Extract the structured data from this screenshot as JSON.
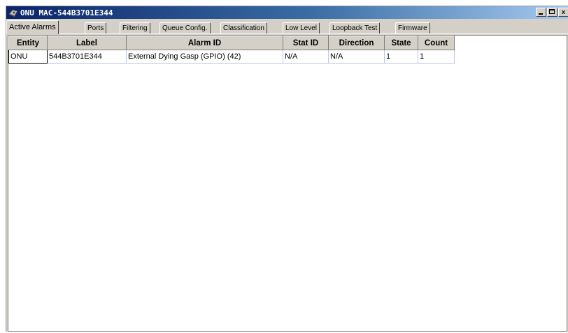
{
  "window": {
    "title": "ONU MAC-544B3701E344",
    "controls": {
      "minimize": "minimize",
      "maximize": "maximize",
      "close": "x"
    }
  },
  "tabs": [
    {
      "label": "Active Alarms",
      "active": true
    },
    {
      "label": "Ports"
    },
    {
      "label": "Filtering"
    },
    {
      "label": "Queue Config."
    },
    {
      "label": "Classification"
    },
    {
      "label": "Low Level"
    },
    {
      "label": "Loopback Test"
    },
    {
      "label": "Firmware"
    }
  ],
  "table": {
    "columns": [
      "Entity",
      "Label",
      "Alarm ID",
      "Stat ID",
      "Direction",
      "State",
      "Count"
    ],
    "rows": [
      [
        "ONU",
        "544B3701E344",
        "External Dying Gasp (GPIO) (42)",
        "N/A",
        "N/A",
        "1",
        "1"
      ]
    ]
  },
  "icons": {
    "app": "onu-app-icon",
    "minimize": "minimize-icon",
    "maximize": "maximize-icon",
    "close": "close-icon"
  },
  "colors": {
    "titlebar_start": "#0a246a",
    "titlebar_end": "#a6caf0",
    "face": "#d4d0c8",
    "grid_line": "#b9c6e8"
  }
}
